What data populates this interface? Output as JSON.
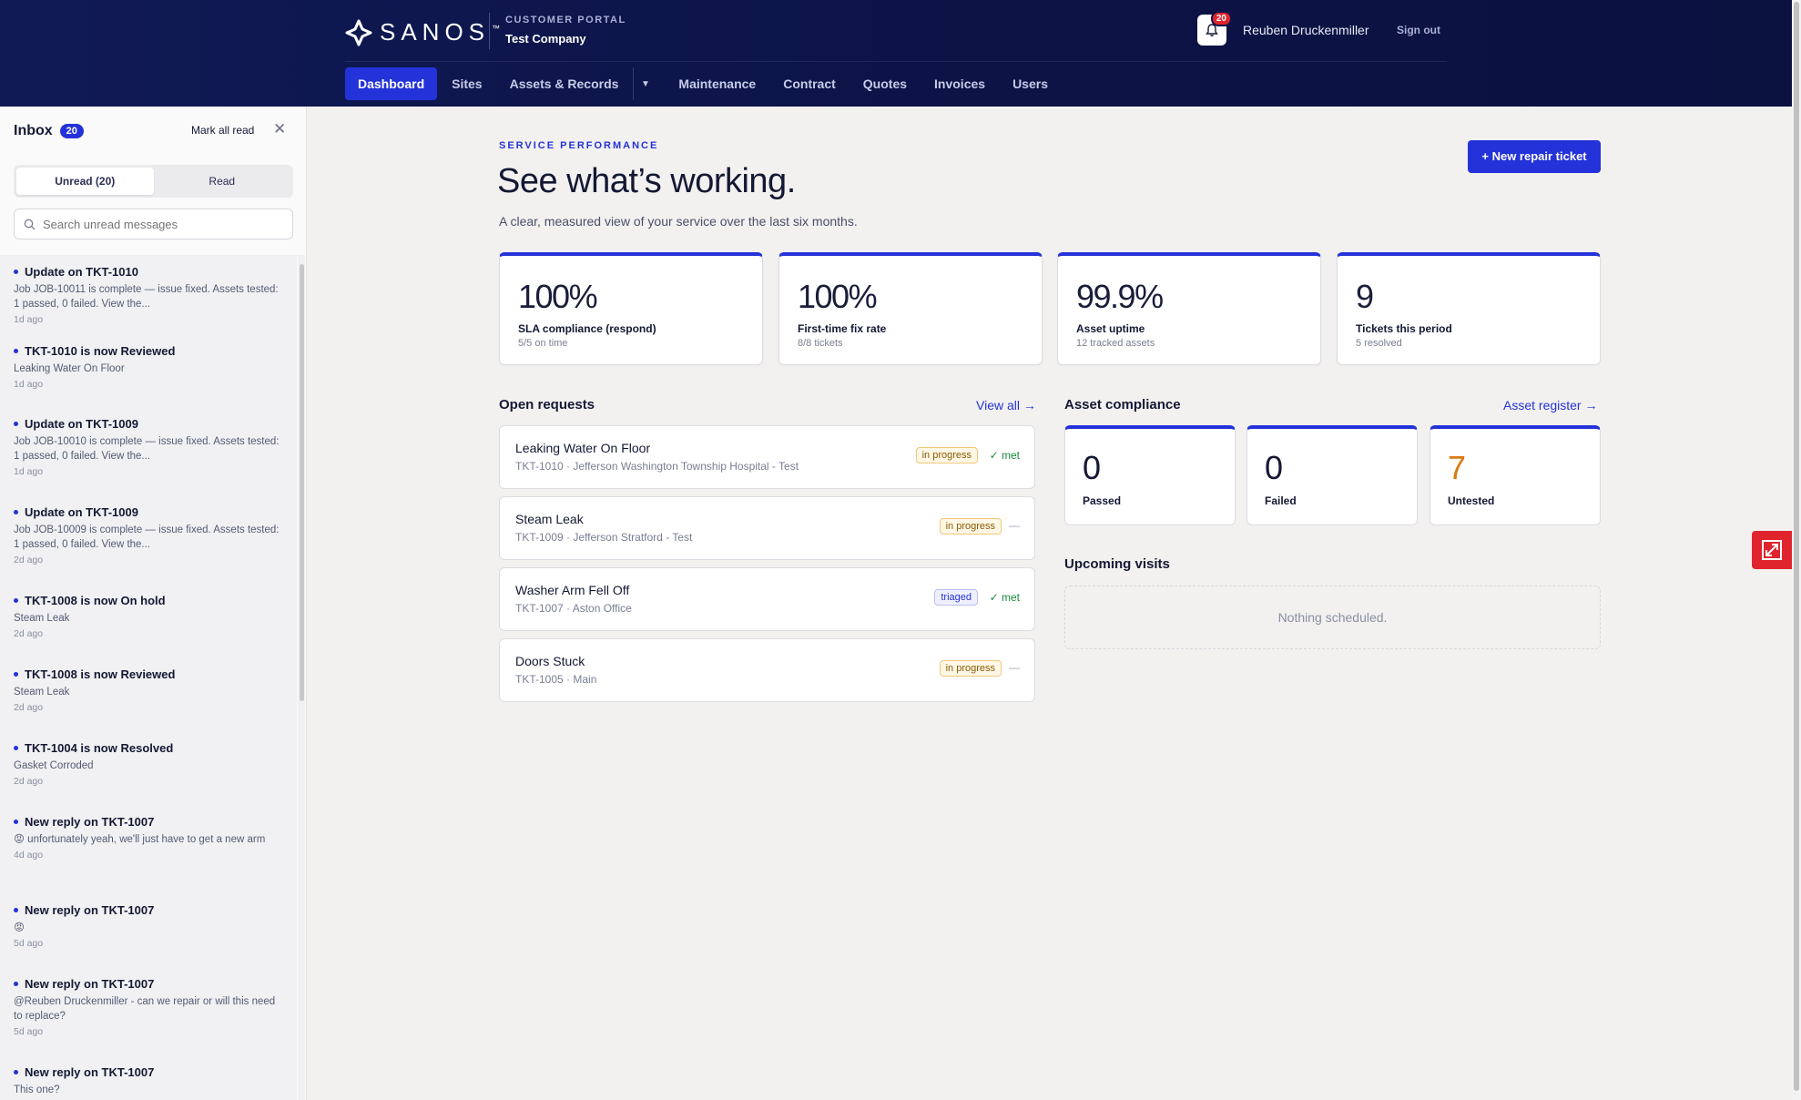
{
  "header": {
    "brand": "SANOS",
    "portal_label": "CUSTOMER PORTAL",
    "company": "Test Company",
    "notification_count": "20",
    "user_name": "Reuben Druckenmiller",
    "signout": "Sign out",
    "nav": [
      "Dashboard",
      "Sites",
      "Assets & Records",
      "Maintenance",
      "Contract",
      "Quotes",
      "Invoices",
      "Users"
    ],
    "nav_active": "Dashboard"
  },
  "inbox": {
    "title": "Inbox",
    "count": "20",
    "mark_all": "Mark all read",
    "tab_unread": "Unread (20)",
    "tab_read": "Read",
    "search_placeholder": "Search unread messages",
    "messages": [
      {
        "title": "Update on TKT-1010",
        "body": "Job JOB-10011 is complete — issue fixed. Assets tested: 1 passed, 0 failed. View the...",
        "time": "1d ago"
      },
      {
        "title": "TKT-1010 is now Reviewed",
        "body": "Leaking Water On Floor",
        "time": "1d ago"
      },
      {
        "title": "Update on TKT-1009",
        "body": "Job JOB-10010 is complete — issue fixed. Assets tested: 1 passed, 0 failed. View the...",
        "time": "1d ago"
      },
      {
        "title": "Update on TKT-1009",
        "body": "Job JOB-10009 is complete — issue fixed. Assets tested: 1 passed, 0 failed. View the...",
        "time": "2d ago"
      },
      {
        "title": "TKT-1008 is now On hold",
        "body": "Steam Leak",
        "time": "2d ago"
      },
      {
        "title": "TKT-1008 is now Reviewed",
        "body": "Steam Leak",
        "time": "2d ago"
      },
      {
        "title": "TKT-1004 is now Resolved",
        "body": "Gasket Corroded",
        "time": "2d ago"
      },
      {
        "title": "New reply on TKT-1007",
        "body": "😡 unfortunately yeah, we'll just have to get a new arm",
        "time": "4d ago"
      },
      {
        "title": "New reply on TKT-1007",
        "body": "😡",
        "time": "5d ago"
      },
      {
        "title": "New reply on TKT-1007",
        "body": "@Reuben Druckenmiller - can we repair or will this need to replace?",
        "time": "5d ago"
      },
      {
        "title": "New reply on TKT-1007",
        "body": "This one?",
        "time": ""
      }
    ]
  },
  "main": {
    "eyebrow": "SERVICE PERFORMANCE",
    "title": "See what’s working.",
    "subtitle": "A clear, measured view of your service over the last six months.",
    "new_ticket": "+ New repair ticket",
    "kpis": [
      {
        "value": "100%",
        "label": "SLA compliance (respond)",
        "sub": "5/5 on time"
      },
      {
        "value": "100%",
        "label": "First-time fix rate",
        "sub": "8/8 tickets"
      },
      {
        "value": "99.9%",
        "label": "Asset uptime",
        "sub": "12 tracked assets"
      },
      {
        "value": "9",
        "label": "Tickets this period",
        "sub": "5 resolved"
      }
    ],
    "open_requests_title": "Open requests",
    "view_all": "View all →",
    "requests": [
      {
        "title": "Leaking Water On Floor",
        "sub": "TKT-1010 · Jefferson Washington Township Hospital - Test",
        "status": "in progress",
        "sla": "met"
      },
      {
        "title": "Steam Leak",
        "sub": "TKT-1009 · Jefferson Stratford - Test",
        "status": "in progress",
        "sla": "—"
      },
      {
        "title": "Washer Arm Fell Off",
        "sub": "TKT-1007 · Aston Office",
        "status": "triaged",
        "sla": "met"
      },
      {
        "title": "Doors Stuck",
        "sub": "TKT-1005 · Main",
        "status": "in progress",
        "sla": "—"
      }
    ],
    "compliance_title": "Asset compliance",
    "asset_register": "Asset register →",
    "compliance": [
      {
        "value": "0",
        "label": "Passed"
      },
      {
        "value": "0",
        "label": "Failed"
      },
      {
        "value": "7",
        "label": "Untested"
      }
    ],
    "visits_title": "Upcoming visits",
    "visits_empty": "Nothing scheduled."
  },
  "colors": {
    "accent": "#2432d9",
    "header": "#0c1447",
    "warning": "#d87a12",
    "alert": "#e0242d"
  }
}
